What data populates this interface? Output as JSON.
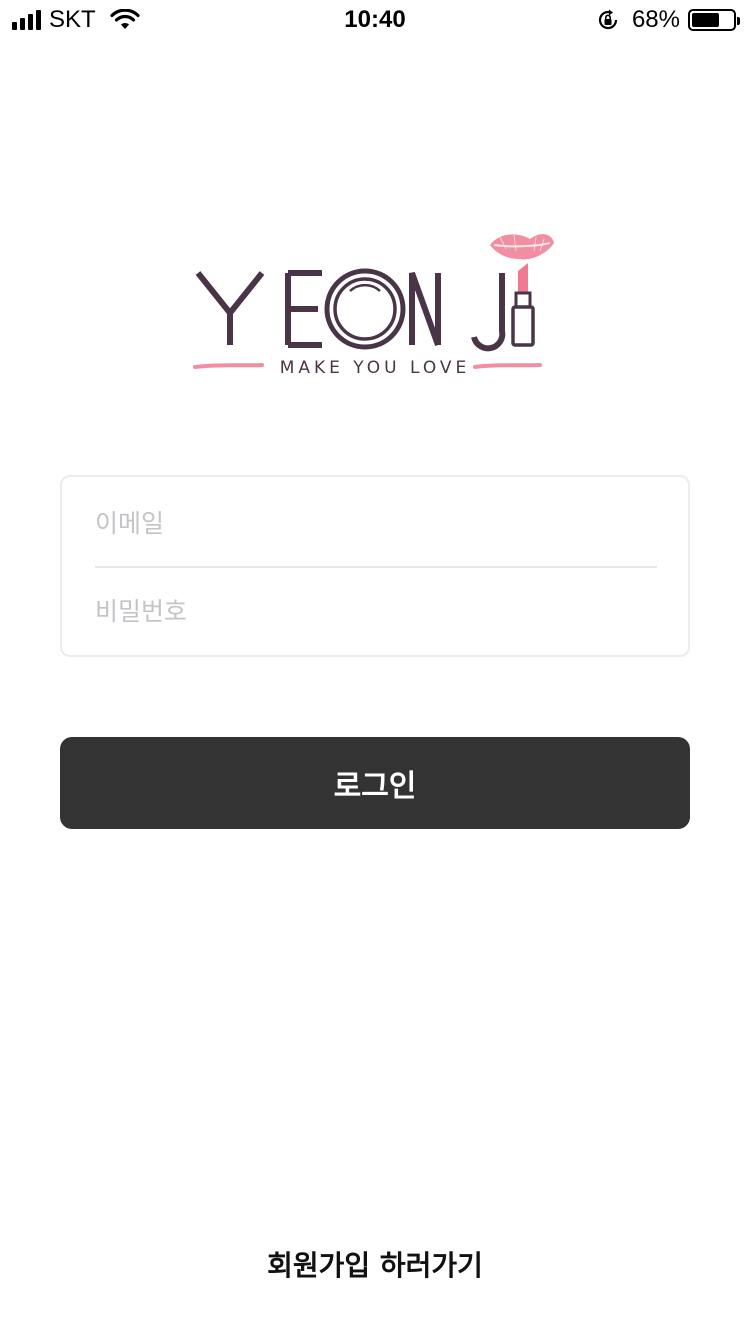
{
  "status_bar": {
    "carrier": "SKT",
    "time": "10:40",
    "battery_percent": "68%",
    "battery_level": 0.68,
    "icons": [
      "signal-icon",
      "wifi-icon",
      "orientation-lock-icon",
      "battery-icon"
    ]
  },
  "logo": {
    "wordmark": "YEON JI",
    "tagline": "MAKE YOU LOVE"
  },
  "login_form": {
    "email_placeholder": "이메일",
    "email_value": "",
    "password_placeholder": "비밀번호",
    "password_value": ""
  },
  "login_button_label": "로그인",
  "signup_link_label": "회원가입 하러가기",
  "colors": {
    "brand_purple": "#4a3447",
    "brand_pink": "#f07a92",
    "button_bg": "#333333",
    "placeholder": "#c4c4c8"
  }
}
